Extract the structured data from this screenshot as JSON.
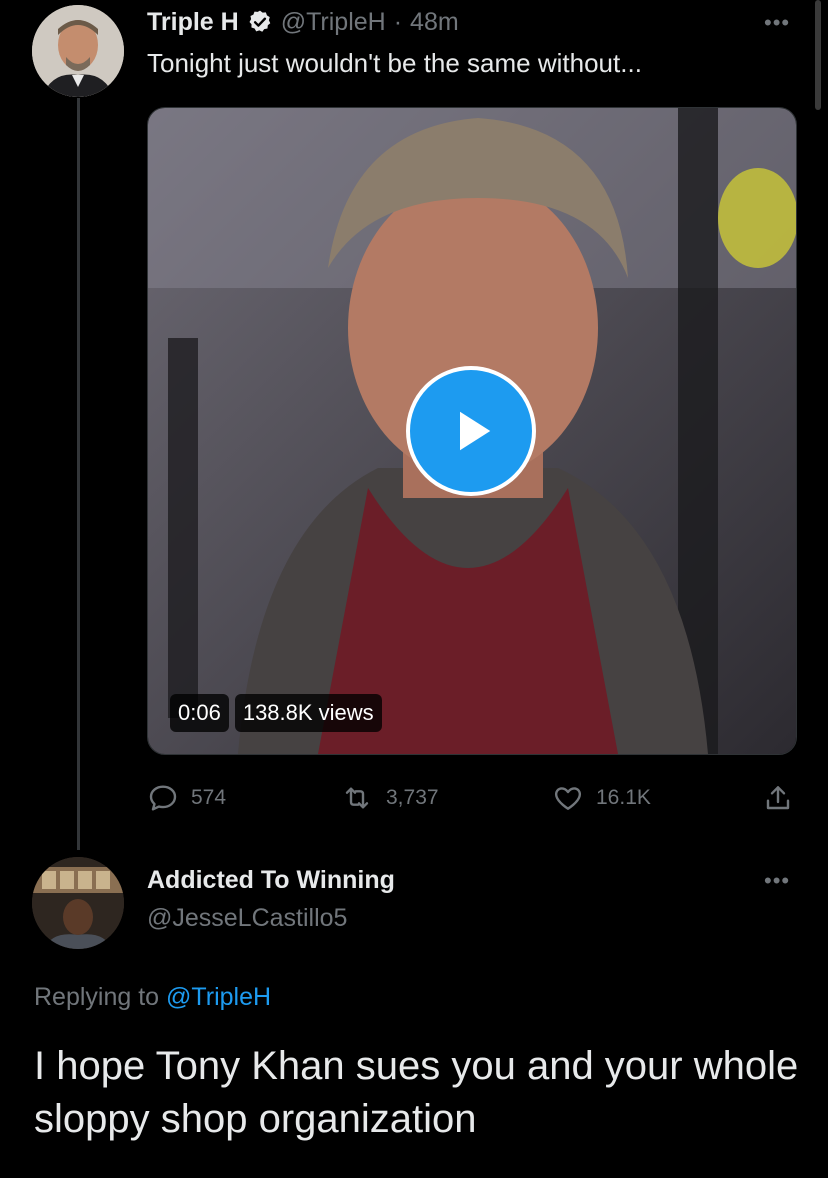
{
  "tweet": {
    "author_name": "Triple H",
    "handle": "@TripleH",
    "separator": "·",
    "time": "48m",
    "text": "Tonight just wouldn't be the same without...",
    "more_icon": "more-horizontal-icon",
    "video": {
      "duration": "0:06",
      "views": "138.8K views",
      "play_icon": "play-icon"
    },
    "actions": {
      "replies": "574",
      "retweets": "3,737",
      "likes": "16.1K"
    }
  },
  "reply": {
    "author_name": "Addicted To Winning",
    "handle": "@JesseLCastillo5",
    "replying_prefix": "Replying to",
    "replying_to": "@TripleH",
    "text": "I hope Tony Khan sues you and your whole sloppy shop organization"
  },
  "colors": {
    "background": "#000000",
    "accent": "#1d9bf0",
    "muted": "#71767b",
    "text": "#e7e9ea"
  }
}
